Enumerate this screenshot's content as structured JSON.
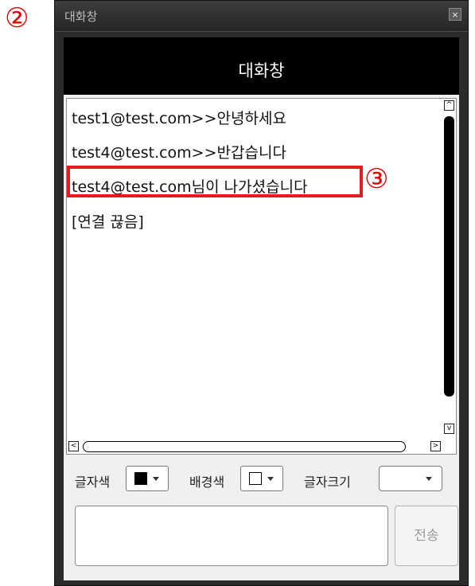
{
  "annotations": {
    "label_2": "②",
    "label_3": "③"
  },
  "window": {
    "title": "대화창",
    "close_symbol": "×"
  },
  "header": {
    "title": "대화창"
  },
  "messages": [
    "test1@test.com>>안녕하세요",
    "test4@test.com>>반갑습니다",
    "test4@test.com님이 나가셨습니다",
    "[연결 끊음]"
  ],
  "scroll": {
    "up": "^",
    "down": "v",
    "left": "<",
    "right": ">"
  },
  "toolbar": {
    "font_color_label": "글자색",
    "font_color": "#000000",
    "bg_color_label": "배경색",
    "bg_color": "#ffffff",
    "font_size_label": "글자크기",
    "font_size_value": ""
  },
  "compose": {
    "input_value": "",
    "send_label": "전송"
  },
  "colors": {
    "highlight": "#e41b1b",
    "annotation": "#e00000",
    "header_bg": "#000000"
  }
}
